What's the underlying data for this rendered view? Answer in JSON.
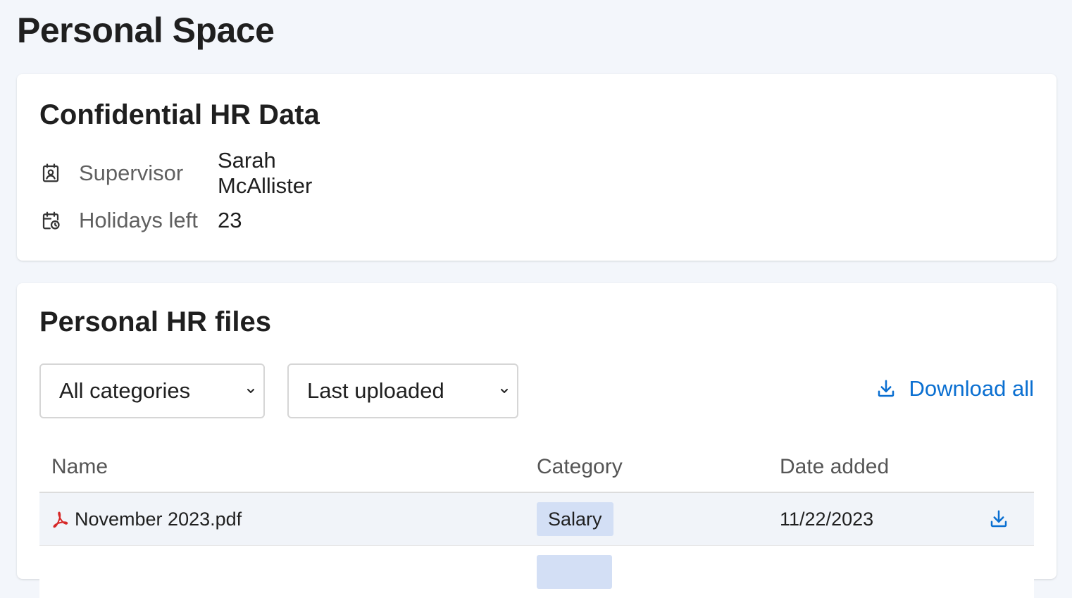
{
  "page": {
    "title": "Personal Space"
  },
  "hr_card": {
    "title": "Confidential HR Data",
    "rows": [
      {
        "icon": "contact-card-icon",
        "label": "Supervisor",
        "value": "Sarah McAllister"
      },
      {
        "icon": "calendar-clock-icon",
        "label": "Holidays left",
        "value": "23"
      }
    ]
  },
  "files_card": {
    "title": "Personal HR files",
    "category_filter": {
      "selected": "All categories"
    },
    "sort_filter": {
      "selected": "Last uploaded"
    },
    "download_all_label": "Download all",
    "table": {
      "columns": [
        "Name",
        "Category",
        "Date added"
      ],
      "rows": [
        {
          "icon": "pdf-icon",
          "name": "November 2023.pdf",
          "category": "Salary",
          "date": "11/22/2023",
          "action_icon": "download-icon"
        }
      ]
    }
  },
  "colors": {
    "background": "#f3f6fb",
    "accent": "#0a6fd1",
    "badge_bg": "#d3dff5",
    "pdf_red": "#d62828"
  }
}
